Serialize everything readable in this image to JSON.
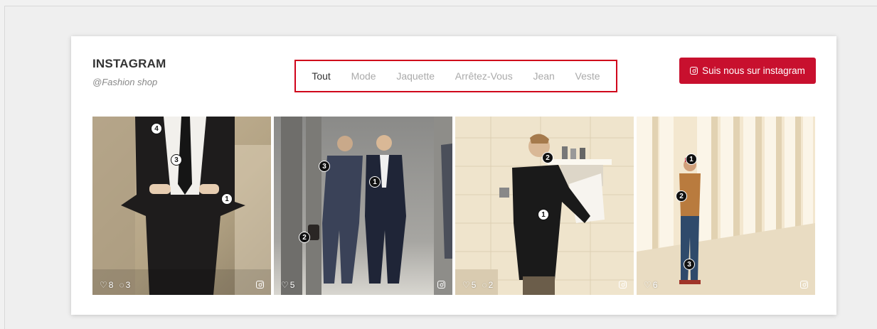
{
  "header": {
    "title": "INSTAGRAM",
    "subtitle": "@Fashion shop"
  },
  "filters": {
    "items": [
      "Tout",
      "Mode",
      "Jaquette",
      "Arrêtez-Vous",
      "Jean",
      "Veste"
    ],
    "active": "Tout",
    "highlight_color": "#d0021b"
  },
  "follow_button": {
    "label": "Suis nous sur instagram",
    "icon": "instagram-icon",
    "color": "#c8102e"
  },
  "photos": [
    {
      "likes": "8",
      "comments": "3",
      "tags": [
        "1",
        "3",
        "4"
      ]
    },
    {
      "likes": "5",
      "comments": "",
      "tags": [
        "1",
        "2",
        "3"
      ]
    },
    {
      "likes": "5",
      "comments": "2",
      "tags": [
        "1",
        "2"
      ]
    },
    {
      "likes": "6",
      "comments": "",
      "tags": [
        "1",
        "2",
        "3"
      ]
    }
  ]
}
